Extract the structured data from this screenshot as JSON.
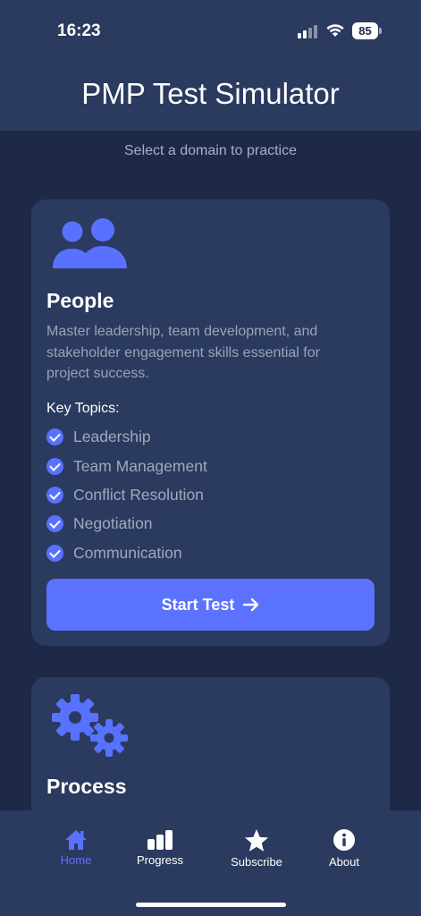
{
  "status_bar": {
    "time": "16:23",
    "battery": "85"
  },
  "header": {
    "title": "PMP Test Simulator"
  },
  "subtitle": "Select a domain to practice",
  "cards": [
    {
      "icon": "people-icon",
      "title": "People",
      "description": "Master leadership, team development, and stakeholder engagement skills essential for project success.",
      "topics_label": "Key Topics:",
      "topics": [
        "Leadership",
        "Team Management",
        "Conflict Resolution",
        "Negotiation",
        "Communication"
      ],
      "button_label": "Start Test"
    },
    {
      "icon": "gears-icon",
      "title": "Process"
    }
  ],
  "tabbar": {
    "items": [
      {
        "label": "Home",
        "icon": "home-icon",
        "active": true
      },
      {
        "label": "Progress",
        "icon": "bar-chart-icon",
        "active": false
      },
      {
        "label": "Subscribe",
        "icon": "star-icon",
        "active": false
      },
      {
        "label": "About",
        "icon": "info-icon",
        "active": false
      }
    ]
  },
  "colors": {
    "background": "#1e2947",
    "surface": "#2b3a5f",
    "accent": "#5b72ff",
    "muted_text": "#a0a8bc"
  }
}
